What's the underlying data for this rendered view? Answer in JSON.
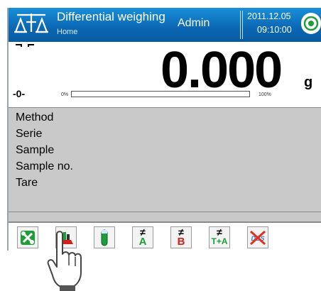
{
  "header": {
    "title": "Differential weighing",
    "subtitle": "Home",
    "user": "Admin",
    "date": "2011.12.05",
    "time": "09:10:00",
    "logo_icon": "balance-scale-icon",
    "status_icon": "status-indicator-icon"
  },
  "weighing": {
    "stability_indicator": "⌐ ¬",
    "zero_indicator": "-0-",
    "reading": "0.000",
    "unit": "g",
    "progress": {
      "min_label": "0%",
      "max_label": "100%",
      "fraction": 0.0
    }
  },
  "info_panel": {
    "rows": [
      {
        "label": "Method"
      },
      {
        "label": "Serie"
      },
      {
        "label": "Sample"
      },
      {
        "label": "Sample no."
      },
      {
        "label": "Tare"
      }
    ]
  },
  "toolbar": {
    "buttons": [
      {
        "icon": "tools-settings-icon"
      },
      {
        "icon": "tare-select-icon"
      },
      {
        "icon": "test-tube-icon"
      },
      {
        "icon": "differential-a-icon",
        "symbol": "≠",
        "letter": "A",
        "color": "#1e9e3a"
      },
      {
        "icon": "differential-b-icon",
        "symbol": "≠",
        "letter": "B",
        "color": "#d0201a"
      },
      {
        "icon": "differential-tare-a-icon",
        "symbol": "≠",
        "letter": "T+A",
        "color": "#1e9e3a"
      },
      {
        "icon": "database-disabled-icon",
        "label": "DBS"
      }
    ]
  },
  "colors": {
    "header_blue": "#0b67b4",
    "panel_gray": "#c9c9c9",
    "accent_green": "#1e9e3a",
    "accent_red": "#d0201a"
  },
  "overlay": {
    "icon": "pointing-hand-icon"
  }
}
